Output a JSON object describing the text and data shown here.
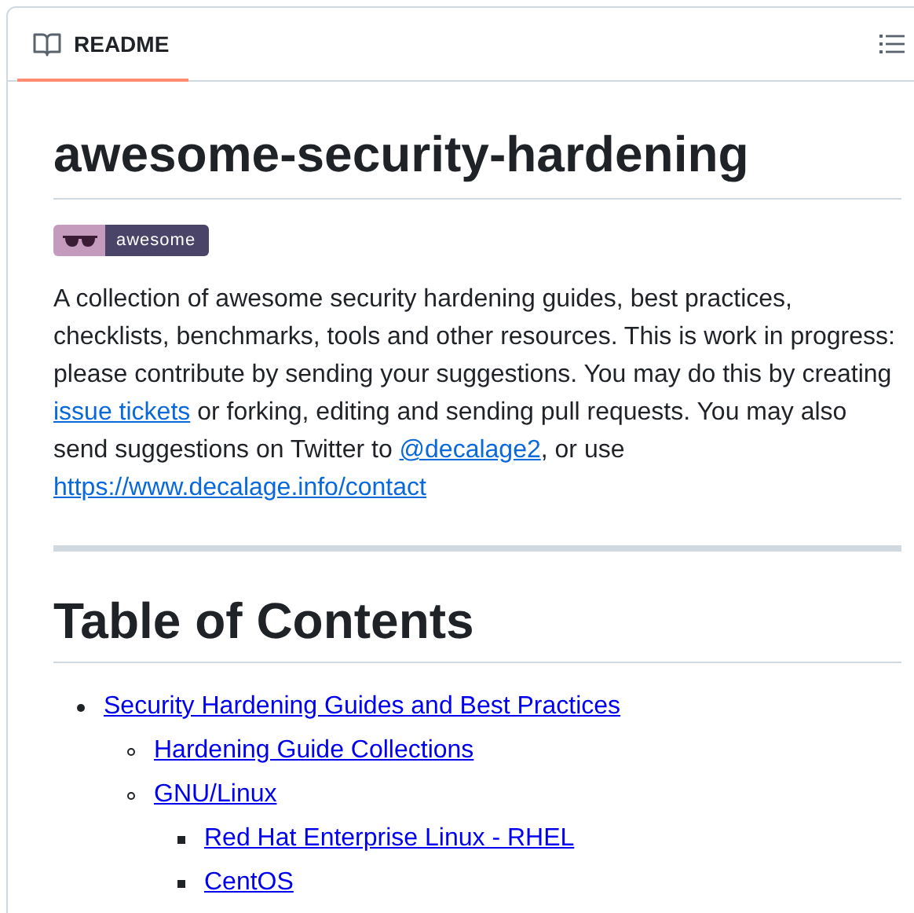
{
  "tab": {
    "label": "README",
    "selected": true
  },
  "title": "awesome-security-hardening",
  "badge": {
    "label": "awesome"
  },
  "intro": [
    {
      "kind": "text",
      "text": "A collection of awesome security hardening guides, best practices, checklists, benchmarks, tools and other resources. This is work in progress: please contribute by sending your suggestions. You may do this by creating "
    },
    {
      "kind": "link",
      "text": "issue tickets"
    },
    {
      "kind": "text",
      "text": " or forking, editing and sending pull requests. You may also send suggestions on Twitter to "
    },
    {
      "kind": "link",
      "text": "@decalage2"
    },
    {
      "kind": "text",
      "text": ", or use "
    },
    {
      "kind": "link",
      "text": "https://www.decalage.info/contact"
    }
  ],
  "toc_heading": "Table of Contents",
  "toc": [
    {
      "label": "Security Hardening Guides and Best Practices",
      "children": [
        {
          "label": "Hardening Guide Collections"
        },
        {
          "label": "GNU/Linux",
          "children": [
            {
              "label": "Red Hat Enterprise Linux - RHEL"
            },
            {
              "label": "CentOS"
            }
          ]
        }
      ]
    }
  ]
}
